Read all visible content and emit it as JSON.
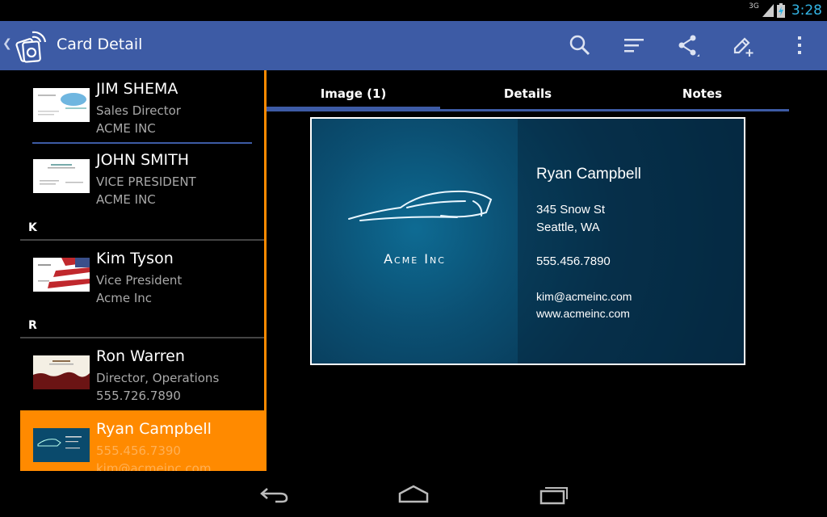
{
  "status_bar": {
    "network": "3G",
    "time": "3:28"
  },
  "action_bar": {
    "title": "Card Detail",
    "actions": [
      "search-icon",
      "sort-icon",
      "share-icon",
      "edit-add-icon",
      "overflow-menu-icon"
    ]
  },
  "contacts": [
    {
      "name": "JIM SHEMA",
      "line1": "Sales Director",
      "line2": "ACME INC"
    },
    {
      "name": "JOHN SMITH",
      "line1": "VICE PRESIDENT",
      "line2": "ACME INC"
    },
    {
      "name": "Kim Tyson",
      "line1": "Vice President",
      "line2": "Acme Inc"
    },
    {
      "name": "Ron Warren",
      "line1": "Director, Operations",
      "line2": "555.726.7890"
    },
    {
      "name": "Ryan Campbell",
      "line1": "555.456.7390",
      "line2": "kim@acmeinc.com"
    }
  ],
  "sections": [
    "K",
    "R"
  ],
  "tabs": [
    "Image (1)",
    "Details",
    "Notes"
  ],
  "selected_tab": 0,
  "card": {
    "company": "Acme Inc",
    "name": "Ryan Campbell",
    "address1": "345 Snow St",
    "address2": "Seattle, WA",
    "phone": "555.456.7890",
    "email": "kim@acmeinc.com",
    "website": "www.acmeinc.com"
  },
  "colors": {
    "accent": "#ff8a00",
    "actionbar": "#3d5ba5",
    "clock": "#33b5e5"
  },
  "nav_bar": [
    "back-icon",
    "home-icon",
    "recents-icon"
  ]
}
